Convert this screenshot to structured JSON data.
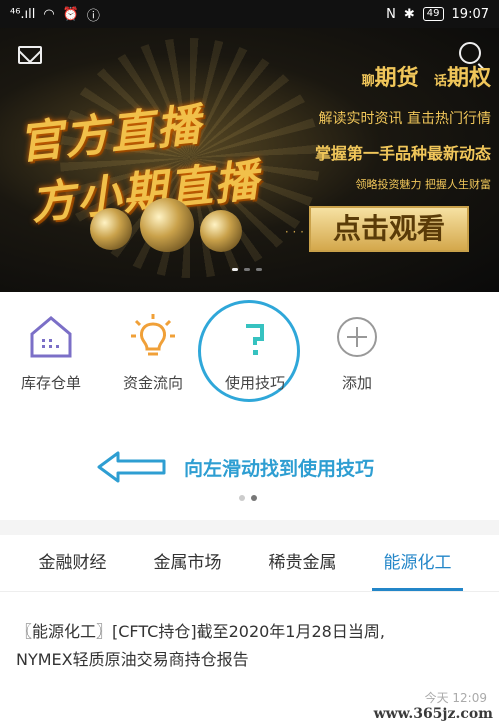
{
  "status_bar": {
    "left": "⁴⁶.ıll",
    "right_icons": [
      "N",
      "✱"
    ],
    "battery": "49",
    "time": "19:07"
  },
  "banner": {
    "title_line1": "官方直播",
    "title_line2": "方小期直播",
    "right_copy": {
      "line1_a_small": "聊",
      "line1_a": "期货",
      "line1_b_small": "话",
      "line1_b": "期权",
      "line2": "解读实时资讯 直击热门行情",
      "line3": "掌握第一手品种最新动态",
      "line4": "领略投资魅力 把握人生财富"
    },
    "cta": "点击观看",
    "cta_deco": "· · ·"
  },
  "tools": [
    {
      "label": "库存仓单",
      "icon": "warehouse-icon"
    },
    {
      "label": "资金流向",
      "icon": "bulb-icon"
    },
    {
      "label": "使用技巧",
      "icon": "question-icon"
    },
    {
      "label": "添加",
      "icon": "plus-icon"
    }
  ],
  "hint": {
    "text": "向左滑动找到使用技巧"
  },
  "tabs": [
    {
      "label": "金融财经",
      "active": false
    },
    {
      "label": "金属市场",
      "active": false
    },
    {
      "label": "稀贵金属",
      "active": false
    },
    {
      "label": "能源化工",
      "active": true
    }
  ],
  "news": {
    "headline_line1": "〖能源化工〗[CFTC持仓]截至2020年1月28日当周,",
    "headline_line2": "NYMEX轻质原油交易商持仓报告",
    "time": "今天 12:09"
  },
  "watermark": "www.365jz.com",
  "colors": {
    "accent": "#2386c8",
    "hint": "#2e9ed2",
    "gold": "#f0c65a"
  }
}
